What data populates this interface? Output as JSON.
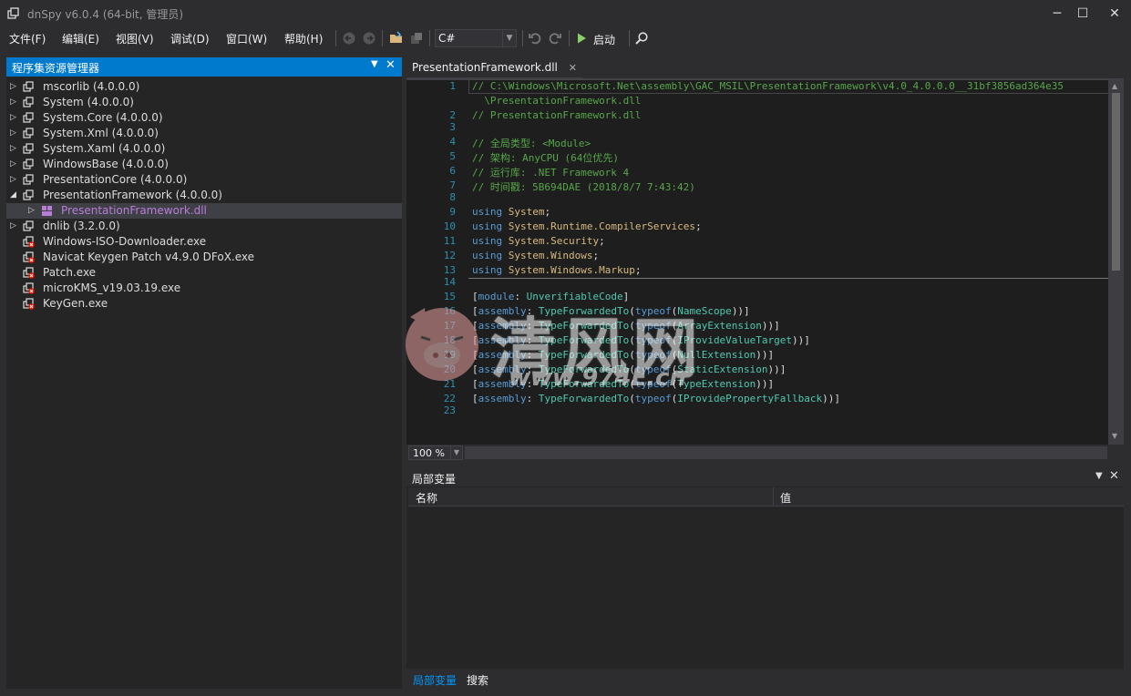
{
  "window": {
    "title": "dnSpy v6.0.4 (64-bit, 管理员)",
    "minimize": "─",
    "maximize": "☐",
    "close": "✕"
  },
  "menu": [
    "文件(F)",
    "编辑(E)",
    "视图(V)",
    "调试(D)",
    "窗口(W)",
    "帮助(H)"
  ],
  "toolbar": {
    "language": "C#",
    "start_label": "启动"
  },
  "assembly_explorer": {
    "title": "程序集资源管理器",
    "items": [
      {
        "name": "mscorlib",
        "version": "(4.0.0.0)",
        "expander": "▷",
        "kind": "assembly"
      },
      {
        "name": "System",
        "version": "(4.0.0.0)",
        "expander": "▷",
        "kind": "assembly"
      },
      {
        "name": "System.Core",
        "version": "(4.0.0.0)",
        "expander": "▷",
        "kind": "assembly"
      },
      {
        "name": "System.Xml",
        "version": "(4.0.0.0)",
        "expander": "▷",
        "kind": "assembly"
      },
      {
        "name": "System.Xaml",
        "version": "(4.0.0.0)",
        "expander": "▷",
        "kind": "assembly"
      },
      {
        "name": "WindowsBase",
        "version": "(4.0.0.0)",
        "expander": "▷",
        "kind": "assembly"
      },
      {
        "name": "PresentationCore",
        "version": "(4.0.0.0)",
        "expander": "▷",
        "kind": "assembly"
      },
      {
        "name": "PresentationFramework",
        "version": "(4.0.0.0)",
        "expander": "◢",
        "kind": "assembly"
      },
      {
        "name": "PresentationFramework.dll",
        "version": "",
        "expander": "▷",
        "kind": "module"
      },
      {
        "name": "dnlib",
        "version": "(3.2.0.0)",
        "expander": "▷",
        "kind": "assembly"
      },
      {
        "name": "Windows-ISO-Downloader.exe",
        "version": "",
        "expander": "",
        "kind": "exe"
      },
      {
        "name": "Navicat Keygen Patch v4.9.0 DFoX.exe",
        "version": "",
        "expander": "",
        "kind": "exe"
      },
      {
        "name": "Patch.exe",
        "version": "",
        "expander": "",
        "kind": "exe"
      },
      {
        "name": "microKMS_v19.03.19.exe",
        "version": "",
        "expander": "",
        "kind": "exe"
      },
      {
        "name": "KeyGen.exe",
        "version": "",
        "expander": "",
        "kind": "exe"
      }
    ]
  },
  "editor": {
    "tab_title": "PresentationFramework.dll",
    "tab_close": "✕",
    "line_numbers": [
      "1",
      "2",
      "3",
      "4",
      "5",
      "6",
      "7",
      "8",
      "9",
      "10",
      "11",
      "12",
      "13",
      "14",
      "15",
      "16",
      "17",
      "18",
      "19",
      "20",
      "21",
      "22",
      "23"
    ],
    "lines": {
      "l1a": "// C:\\Windows\\Microsoft.Net\\assembly\\GAC_MSIL\\PresentationFramework\\v4.0_4.0.0.0__31bf3856ad364e35",
      "l1b": "  \\PresentationFramework.dll",
      "l2": "// PresentationFramework.dll",
      "l4": "// 全局类型: <Module>",
      "l5": "// 架构: AnyCPU (64位优先)",
      "l6": "// 运行库: .NET Framework 4",
      "l7": "// 时间戳: 5B694DAE (2018/8/7 7:43:42)",
      "using_kw": "using",
      "ns9": "System",
      "ns10": "System.Runtime.CompilerServices",
      "ns11": "System.Security",
      "ns12": "System.Windows",
      "ns13": "System.Windows.Markup",
      "semicolon": ";",
      "module_kw": "module",
      "assembly_kw": "assembly",
      "attr15": "UnverifiableCode",
      "attr_fwd": "TypeForwardedTo",
      "typeof_kw": "typeof",
      "t16": "NameScope",
      "t17": "ArrayExtension",
      "t18": "IProvideValueTarget",
      "t19": "NullExtension",
      "t20": "StaticExtension",
      "t21": "TypeExtension",
      "t22": "IProvidePropertyFallback"
    },
    "zoom": "100 %"
  },
  "locals": {
    "title": "局部变量",
    "col_name": "名称",
    "col_value": "值",
    "tab_locals": "局部变量",
    "tab_search": "搜索"
  },
  "watermark": {
    "text": "清风网",
    "url": "www.974L.cn"
  },
  "colors": {
    "accent": "#007acc",
    "background": "#2d2d30",
    "panel": "#252526",
    "editor": "#1e1e1e",
    "keyword": "#569cd6",
    "comment": "#57a64a",
    "type": "#4ec9b0",
    "namespace": "#d7ba7d",
    "line_number": "#2b91af"
  }
}
